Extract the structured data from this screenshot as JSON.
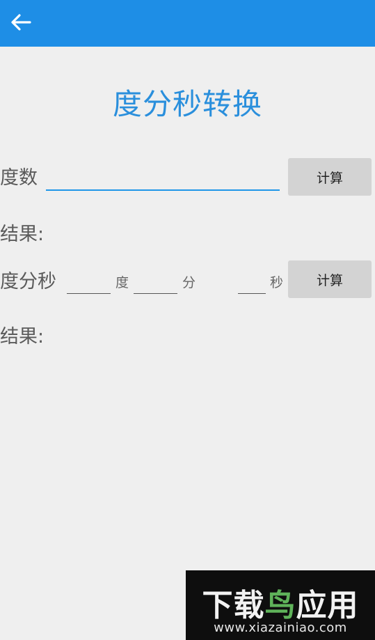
{
  "header": {
    "back_icon": "arrow-left-icon",
    "color": "#1e8ee6"
  },
  "page_title": "度分秒转换",
  "degree_section": {
    "label": "度数",
    "input_value": "",
    "calc_button": "计算",
    "result_label": "结果:"
  },
  "dms_section": {
    "label": "度分秒",
    "deg_value": "",
    "deg_unit": "度",
    "min_value": "",
    "min_unit": "分",
    "sec_value": "",
    "sec_unit": "秒",
    "calc_button": "计算",
    "result_label": "结果:"
  },
  "watermark": {
    "text_part1": "下载",
    "text_part2": "鸟",
    "text_part3": "应用",
    "url": "www.xiazainiao.com"
  }
}
